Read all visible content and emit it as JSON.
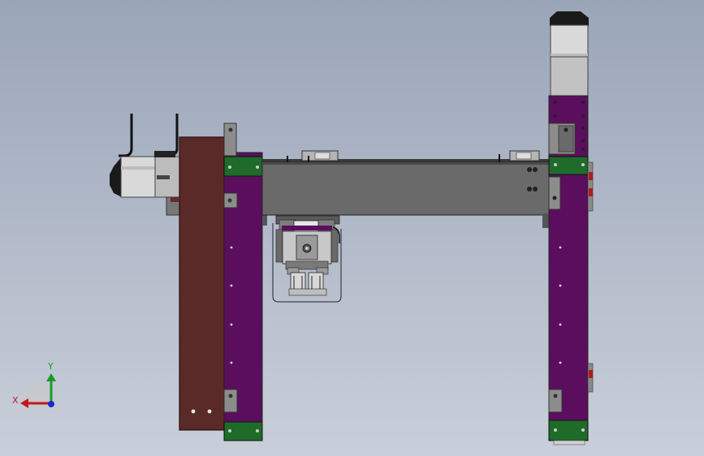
{
  "triad": {
    "x_label": "X",
    "y_label": "Y",
    "x_color": "#c4161c",
    "y_color": "#1a9a2a",
    "z_color": "#1a2ad0"
  },
  "colors": {
    "viewport_top": "#9aa5b8",
    "viewport_bottom": "#c9cfda",
    "column": "#5b0e5e",
    "plate": "#5a2a28",
    "beam": "#6a6a6a",
    "green_block": "#1e6b2a",
    "motor_body": "#c9c9c9"
  }
}
